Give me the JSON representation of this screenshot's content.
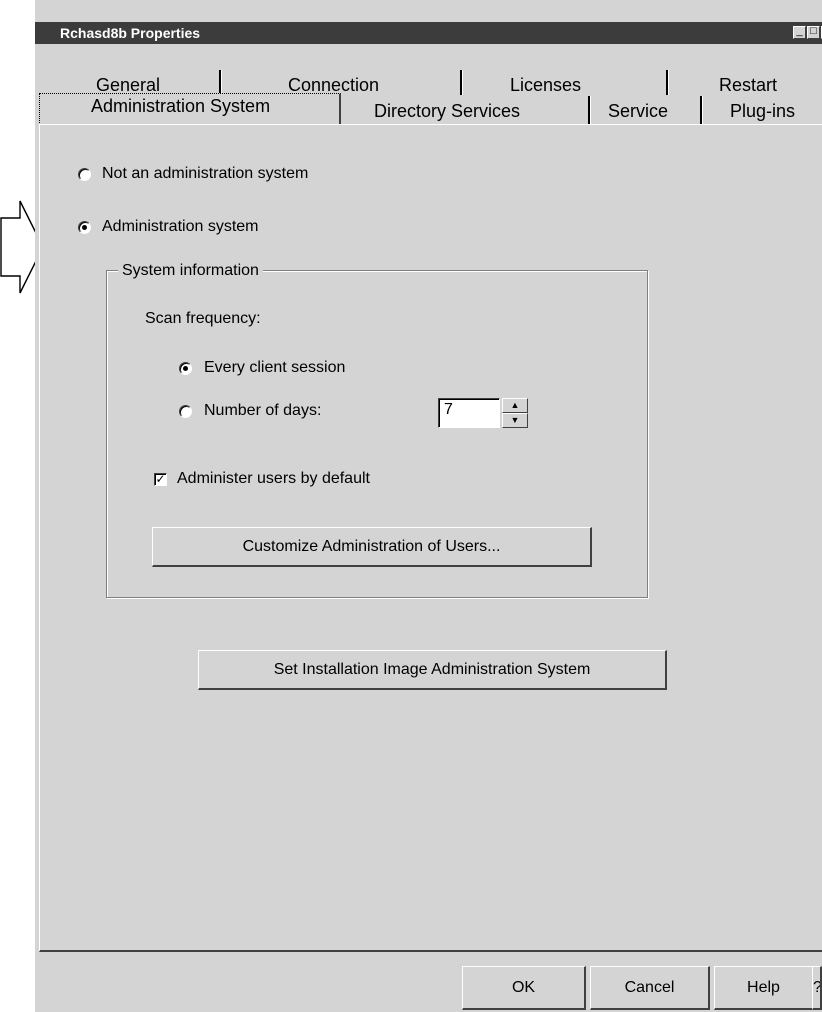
{
  "window": {
    "title": "Rchasd8b Properties"
  },
  "tabs": {
    "back_row": [
      "General",
      "Connection",
      "Licenses",
      "Restart"
    ],
    "front_row": [
      "Administration System",
      "Directory Services",
      "Service",
      "Plug-ins"
    ],
    "active": "Administration System"
  },
  "admin": {
    "option_not_admin": "Not an administration system",
    "option_admin": "Administration system",
    "selected": "Administration system"
  },
  "system_info": {
    "group_title": "System information",
    "scan_frequency_label": "Scan frequency:",
    "every_session_label": "Every client session",
    "number_of_days_label": "Number of days:",
    "number_of_days_value": "7",
    "scan_selected": "Every client session",
    "administer_users_label": "Administer users by default",
    "administer_users_checked": true,
    "customize_button": "Customize Administration of Users..."
  },
  "set_image_button": "Set Installation Image Administration System",
  "footer": {
    "ok": "OK",
    "cancel": "Cancel",
    "help": "Help",
    "extra": "?"
  }
}
